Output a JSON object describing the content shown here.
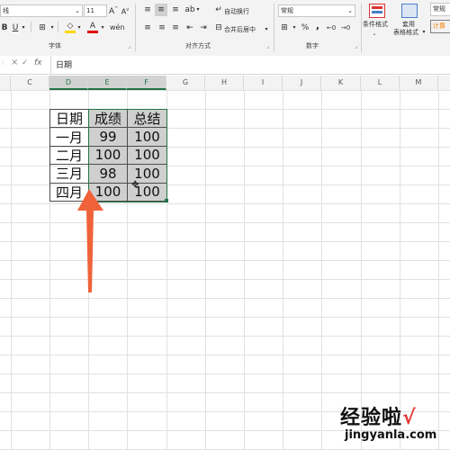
{
  "ribbon": {
    "font_name_partial": "线",
    "font_size": "11",
    "grow_font": "A",
    "shrink_font": "A",
    "bold": "B",
    "italic": "I",
    "underline": "U",
    "font_color_letter": "A",
    "wrap_text": "自动换行",
    "merge_center": "合并后居中",
    "number_format": "常规",
    "percent": "%",
    "comma": ",",
    "conditional_format": "条件格式",
    "table_format_line1": "套用",
    "table_format_line2": "表格格式",
    "style_normal": "常规",
    "style_calc": "计算",
    "group_font": "字体",
    "group_alignment": "对齐方式",
    "group_number": "数字"
  },
  "formula_bar": {
    "cancel": "×",
    "enter": "✓",
    "fx": "fx",
    "content": "日期"
  },
  "columns": [
    "C",
    "D",
    "E",
    "F",
    "G",
    "H",
    "I",
    "J",
    "K",
    "L",
    "M"
  ],
  "table": {
    "header": [
      "日期",
      "成绩",
      "总结"
    ],
    "rows": [
      [
        "一月",
        "99",
        "100"
      ],
      [
        "二月",
        "100",
        "100"
      ],
      [
        "三月",
        "98",
        "100"
      ],
      [
        "四月",
        "100",
        "100"
      ]
    ]
  },
  "watermark": {
    "brand": "经验啦",
    "check": "√",
    "url": "jingyanla.com"
  },
  "colors": {
    "excel_green": "#217346",
    "arrow": "#f0623a",
    "watermark": "#111111",
    "selection_fill": "#cfcfcf"
  }
}
